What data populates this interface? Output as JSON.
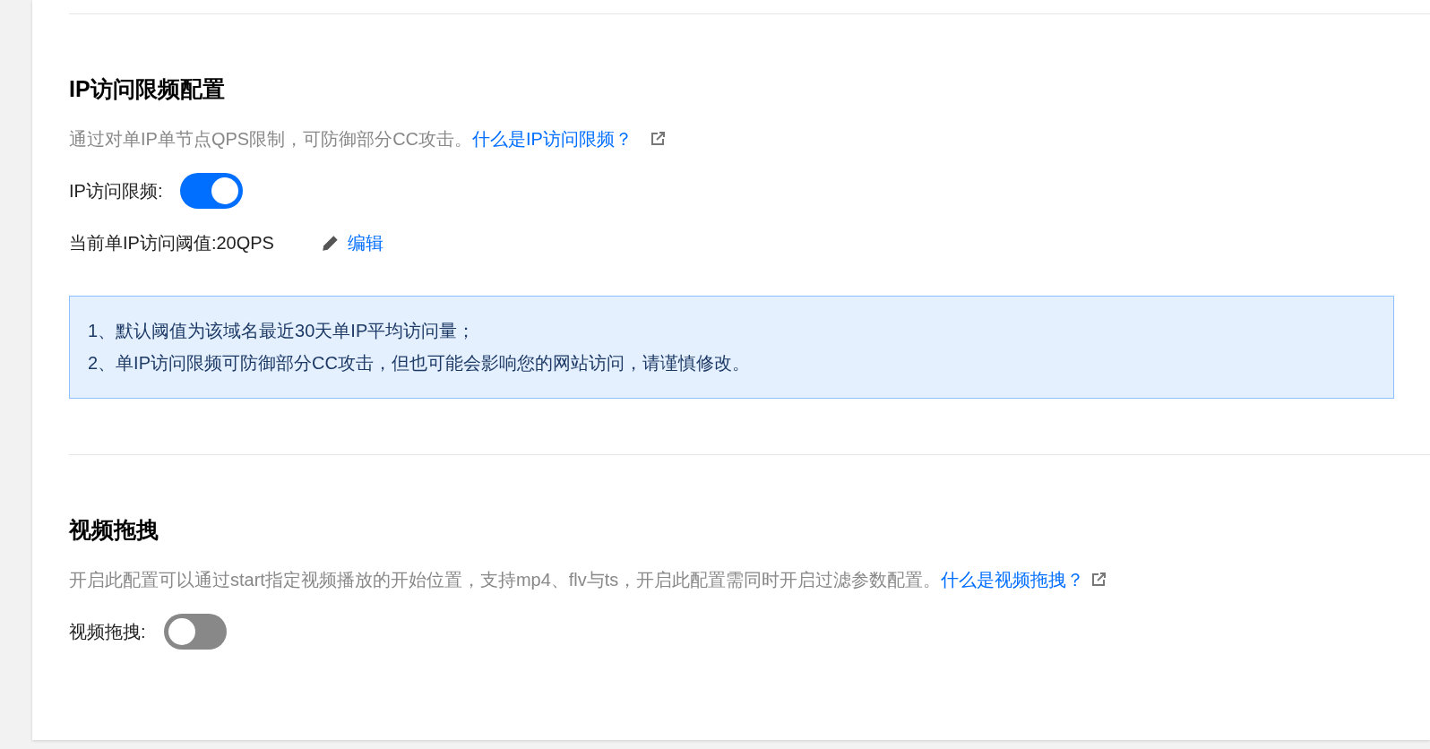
{
  "sections": [
    {
      "title": "IP访问限频配置",
      "description": "通过对单IP单节点QPS限制，可防御部分CC攻击。",
      "help_link": "什么是IP访问限频？",
      "toggle": {
        "label": "IP访问限频:",
        "on": true
      },
      "threshold": {
        "label": "当前单IP访问阈值:20QPS",
        "edit_link": "编辑"
      },
      "notice": [
        "1、默认阈值为该域名最近30天单IP平均访问量；",
        "2、单IP访问限频可防御部分CC攻击，但也可能会影响您的网站访问，请谨慎修改。"
      ]
    },
    {
      "title": "视频拖拽",
      "description": "开启此配置可以通过start指定视频播放的开始位置，支持mp4、flv与ts，开启此配置需同时开启过滤参数配置。",
      "help_link": "什么是视频拖拽？",
      "toggle": {
        "label": "视频拖拽:",
        "on": false
      }
    }
  ]
}
